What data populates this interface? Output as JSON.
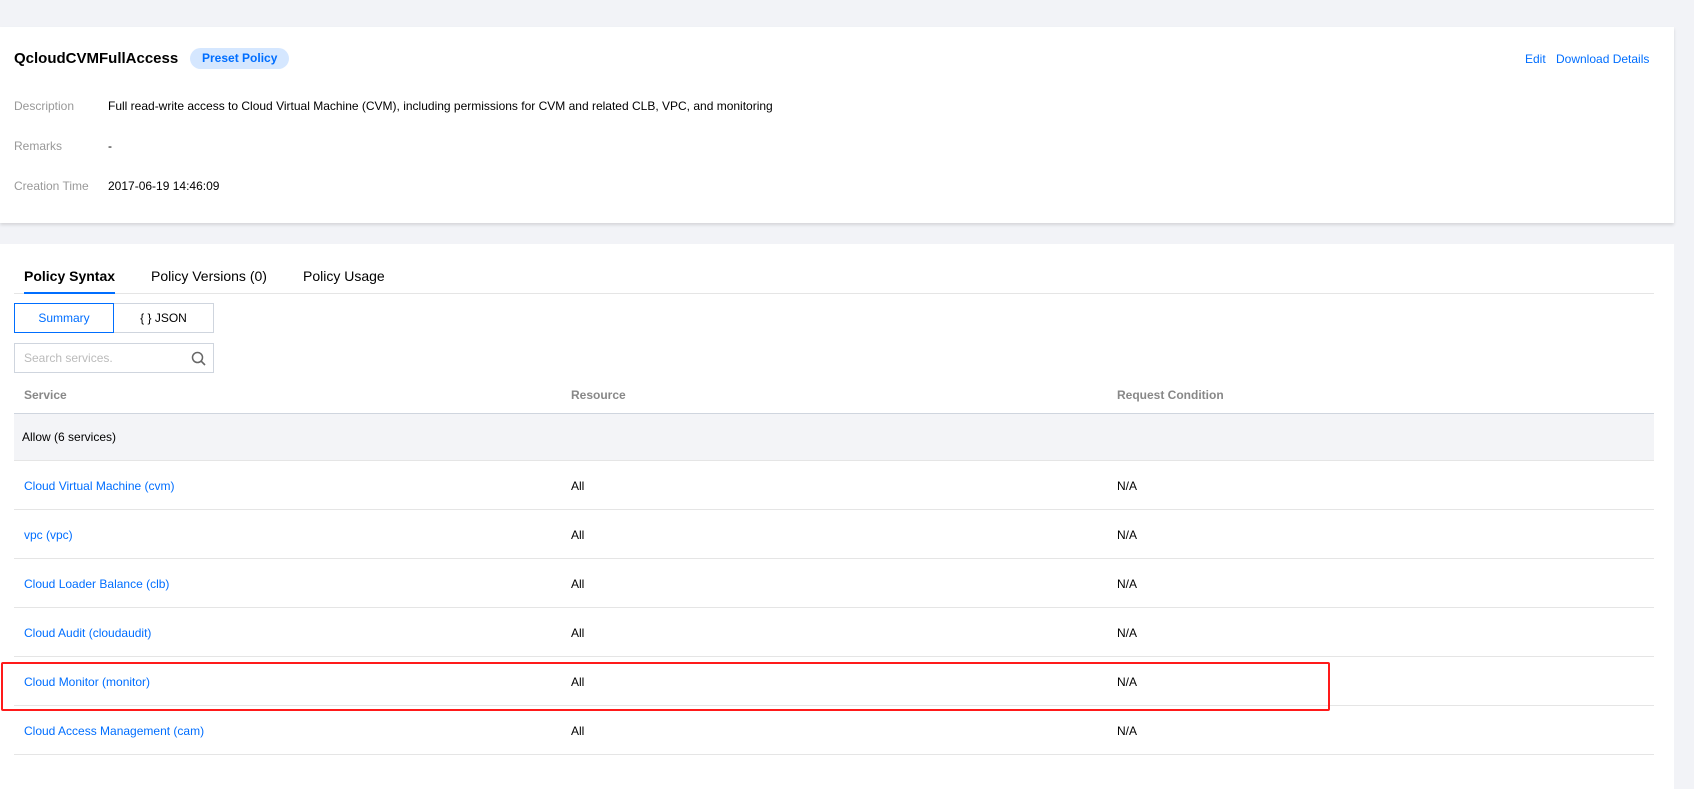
{
  "policy": {
    "name": "QcloudCVMFullAccess",
    "tag": "Preset Policy",
    "actions": {
      "edit": "Edit",
      "download": "Download Details"
    },
    "fields": [
      {
        "label": "Description",
        "value": "Full read-write access to Cloud Virtual Machine (CVM), including permissions for CVM and related CLB, VPC, and monitoring"
      },
      {
        "label": "Remarks",
        "value": "-"
      },
      {
        "label": "Creation Time",
        "value": "2017-06-19 14:46:09"
      }
    ]
  },
  "tabs": [
    {
      "label": "Policy Syntax",
      "active": true
    },
    {
      "label": "Policy Versions (0)",
      "active": false
    },
    {
      "label": "Policy Usage",
      "active": false
    }
  ],
  "view_toggle": {
    "summary": "Summary",
    "json": "{ } JSON",
    "selected": "Summary"
  },
  "search": {
    "placeholder": "Search services."
  },
  "table": {
    "columns": [
      "Service",
      "Resource",
      "Request Condition"
    ],
    "group_label": "Allow (6 services)",
    "rows": [
      {
        "service": "Cloud Virtual Machine (cvm)",
        "resource": "All",
        "condition": "N/A"
      },
      {
        "service": "vpc (vpc)",
        "resource": "All",
        "condition": "N/A"
      },
      {
        "service": "Cloud Loader Balance (clb)",
        "resource": "All",
        "condition": "N/A"
      },
      {
        "service": "Cloud Audit (cloudaudit)",
        "resource": "All",
        "condition": "N/A"
      },
      {
        "service": "Cloud Monitor (monitor)",
        "resource": "All",
        "condition": "N/A"
      },
      {
        "service": "Cloud Access Management (cam)",
        "resource": "All",
        "condition": "N/A"
      }
    ],
    "highlighted_row": "Cloud Monitor (monitor)"
  },
  "colors": {
    "accent": "#006eff",
    "highlight": "#ff1a1a",
    "tag_bg": "#d5e7ff"
  }
}
